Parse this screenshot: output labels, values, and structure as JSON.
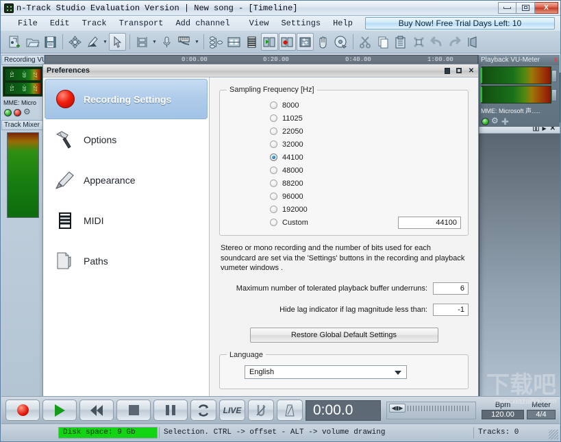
{
  "window": {
    "title": "n-Track Studio Evaluation Version  |  New song - [Timeline]",
    "minimize_label": "Minimize",
    "maximize_label": "Maximize",
    "close_label": "X"
  },
  "menubar": {
    "items": [
      "File",
      "Edit",
      "Track",
      "Transport",
      "Add channel",
      "View",
      "Settings",
      "Help"
    ],
    "buy_now": "Buy Now! Free Trial Days Left: 10"
  },
  "toolbar": {
    "buttons": [
      "new-song-icon",
      "open-song-icon",
      "save-song-icon",
      "move-tool-icon",
      "draw-tool-icon",
      "dropdown-arrow",
      "select-tool-icon",
      "grid-snap-icon",
      "dropdown-arrow",
      "microphone-icon",
      "midi-keyboard-icon",
      "dropdown-arrow",
      "mixer-routing-icon",
      "channel-strip-icon",
      "piano-roll-icon",
      "playback-device-icon",
      "record-device-icon",
      "mixer-icon",
      "hand-tool-icon",
      "cd-burn-icon",
      "cut-icon",
      "copy-icon",
      "paste-icon",
      "delete-icon",
      "undo-icon",
      "redo-icon",
      "zoom-icon"
    ]
  },
  "left_dock": {
    "recording_vu_title": "Recording VU-M",
    "vu_scale": [
      "-51",
      "-39",
      "-27"
    ],
    "device": "MME: Micro",
    "track_mixer_title": "Track Mixer"
  },
  "right_dock": {
    "playback_vu_title": "Playback VU-Meter",
    "close_icon": "x",
    "device": "MME: Microsoft 声....."
  },
  "timeline": {
    "ruler_marks": [
      "0:00.00",
      "0:20.00",
      "0:40.00",
      "1:00.00"
    ],
    "panel_icons": [
      "columns-icon",
      "play-arrow-icon",
      "close-icon"
    ]
  },
  "preferences": {
    "title": "Preferences",
    "window_buttons": [
      "restore-icon",
      "maximize-icon",
      "close-icon"
    ],
    "nav": [
      {
        "label": "Recording Settings",
        "icon": "record-dot-icon",
        "active": true
      },
      {
        "label": "Options",
        "icon": "hammer-icon",
        "active": false
      },
      {
        "label": "Appearance",
        "icon": "paintbrush-icon",
        "active": false
      },
      {
        "label": "MIDI",
        "icon": "midi-keys-icon",
        "active": false
      },
      {
        "label": "Paths",
        "icon": "folder-icon",
        "active": false
      }
    ],
    "sampling": {
      "legend": "Sampling Frequency [Hz]",
      "options": [
        {
          "label": "8000",
          "checked": false
        },
        {
          "label": "11025",
          "checked": false
        },
        {
          "label": "22050",
          "checked": false
        },
        {
          "label": "32000",
          "checked": false
        },
        {
          "label": "44100",
          "checked": true
        },
        {
          "label": "48000",
          "checked": false
        },
        {
          "label": "88200",
          "checked": false
        },
        {
          "label": "96000",
          "checked": false
        },
        {
          "label": "192000",
          "checked": false
        },
        {
          "label": "Custom",
          "checked": false
        }
      ],
      "custom_value": "44100"
    },
    "note": "Stereo or mono recording and the number of bits used for each soundcard are set via the 'Settings' buttons in the recording and playback vumeter windows .",
    "fields": [
      {
        "label": "Maximum number of tolerated playback buffer underruns:",
        "value": "6"
      },
      {
        "label": "Hide lag indicator if lag magnitude less than:",
        "value": "-1"
      }
    ],
    "restore_button": "Restore Global Default Settings",
    "language": {
      "legend": "Language",
      "selected": "English",
      "options": [
        "English"
      ]
    }
  },
  "transport": {
    "buttons": [
      {
        "name": "record-button",
        "icon": "record-circle-icon"
      },
      {
        "name": "play-button",
        "icon": "play-triangle-icon"
      },
      {
        "name": "rewind-button",
        "icon": "rewind-icon"
      },
      {
        "name": "stop-button",
        "icon": "stop-square-icon"
      },
      {
        "name": "pause-button",
        "icon": "pause-bars-icon"
      },
      {
        "name": "loop-button",
        "icon": "loop-arrows-icon"
      },
      {
        "name": "live-button",
        "icon": "live-text-icon",
        "label": "LIVE"
      },
      {
        "name": "punch-button",
        "icon": "magnet-icon"
      },
      {
        "name": "metronome-button",
        "icon": "metronome-icon"
      }
    ],
    "time": "0:00.0",
    "bpm_label": "Bpm",
    "bpm_value": "120.00",
    "meter_label": "Meter",
    "meter_value": "4/4"
  },
  "statusbar": {
    "disk_space": "Disk space: 9 Gb",
    "selection_hint": "Selection. CTRL -> offset - ALT -> volume drawing",
    "tracks": "Tracks: 0"
  },
  "watermark": {
    "big": "下载吧",
    "url": "www.xiazaiba.com"
  },
  "colors": {
    "accent_blue": "#a2c3e6",
    "record_red": "#e01808",
    "disk_green": "#12d412",
    "title_gradient_top": "#f2f6fa"
  }
}
